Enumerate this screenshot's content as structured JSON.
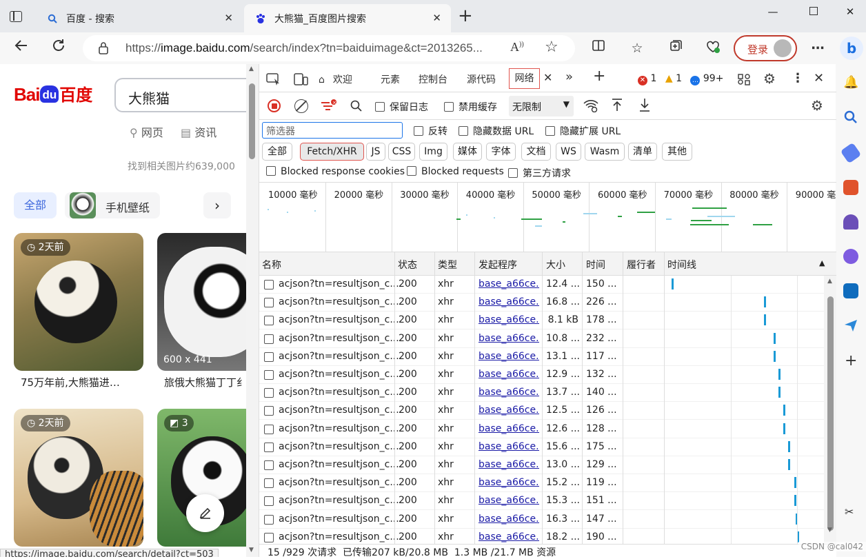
{
  "tabs": [
    {
      "title": "百度 - 搜索",
      "active": false
    },
    {
      "title": "大熊猫_百度图片搜索",
      "active": true
    }
  ],
  "address": {
    "url_prefix": "https://",
    "url_host": "image.baidu.com",
    "url_rest": "/search/index?tn=baiduimage&ct=2013265..."
  },
  "toolbar": {
    "login_label": "登录"
  },
  "baidu": {
    "logo_bai": "Bai",
    "logo_du": "du",
    "logo_cn": "百度",
    "search_query": "大熊猫",
    "nav_web": "网页",
    "nav_news": "资讯",
    "result_count": "找到相关图片约639,000",
    "filter_all": "全部",
    "filter_wallpaper": "手机壁纸",
    "cards": [
      {
        "badge": "2天前",
        "caption": "75万年前,大熊猫进…"
      },
      {
        "size": "600 x 441",
        "caption": "旅俄大熊猫丁丁纟"
      },
      {
        "badge": "2天前",
        "caption": ""
      },
      {
        "count": "3",
        "caption": ""
      }
    ],
    "status_url": "https://image.baidu.com/search/detail?ct=503"
  },
  "devtools": {
    "tabs": [
      "欢迎",
      "元素",
      "控制台",
      "源代码",
      "网络"
    ],
    "errors": "1",
    "warnings": "1",
    "messages": "99+",
    "preserve_log": "保留日志",
    "disable_cache": "禁用缓存",
    "throttle": "无限制",
    "filter_placeholder": "筛选器",
    "invert": "反转",
    "hide_data_url": "隐藏数据 URL",
    "hide_ext_url": "隐藏扩展 URL",
    "type_filters": [
      "全部",
      "Fetch/XHR",
      "JS",
      "CSS",
      "Img",
      "媒体",
      "字体",
      "文档",
      "WS",
      "Wasm",
      "清单",
      "其他"
    ],
    "blocked_cookies": "Blocked response cookies",
    "blocked_requests": "Blocked requests",
    "third_party": "第三方请求",
    "overview_ticks": [
      "10000 毫秒",
      "20000 毫秒",
      "30000 毫秒",
      "40000 毫秒",
      "50000 毫秒",
      "60000 毫秒",
      "70000 毫秒",
      "80000 毫秒",
      "90000 毫"
    ],
    "columns": [
      "名称",
      "状态",
      "类型",
      "发起程序",
      "大小",
      "时间",
      "履行者",
      "时间线"
    ],
    "rows": [
      {
        "name": "acjson?tn=resultjson_c...",
        "status": "200",
        "type": "xhr",
        "initiator": "base_a66ce...",
        "size": "12.4 ...",
        "time": "150 ...",
        "tl": 0.03
      },
      {
        "name": "acjson?tn=resultjson_c...",
        "status": "200",
        "type": "xhr",
        "initiator": "base_a66ce...",
        "size": "16.8 ...",
        "time": "226 ...",
        "tl": 0.62
      },
      {
        "name": "acjson?tn=resultjson_c...",
        "status": "200",
        "type": "xhr",
        "initiator": "base_a66ce...",
        "size": "8.1 kB",
        "time": "178 ...",
        "tl": 0.62
      },
      {
        "name": "acjson?tn=resultjson_c...",
        "status": "200",
        "type": "xhr",
        "initiator": "base_a66ce...",
        "size": "10.8 ...",
        "time": "232 ...",
        "tl": 0.68
      },
      {
        "name": "acjson?tn=resultjson_c...",
        "status": "200",
        "type": "xhr",
        "initiator": "base_a66ce...",
        "size": "13.1 ...",
        "time": "117 ...",
        "tl": 0.68
      },
      {
        "name": "acjson?tn=resultjson_c...",
        "status": "200",
        "type": "xhr",
        "initiator": "base_a66ce...",
        "size": "12.9 ...",
        "time": "132 ...",
        "tl": 0.71
      },
      {
        "name": "acjson?tn=resultjson_c...",
        "status": "200",
        "type": "xhr",
        "initiator": "base_a66ce...",
        "size": "13.7 ...",
        "time": "140 ...",
        "tl": 0.71
      },
      {
        "name": "acjson?tn=resultjson_c...",
        "status": "200",
        "type": "xhr",
        "initiator": "base_a66ce...",
        "size": "12.5 ...",
        "time": "126 ...",
        "tl": 0.74
      },
      {
        "name": "acjson?tn=resultjson_c...",
        "status": "200",
        "type": "xhr",
        "initiator": "base_a66ce...",
        "size": "12.6 ...",
        "time": "128 ...",
        "tl": 0.74
      },
      {
        "name": "acjson?tn=resultjson_c...",
        "status": "200",
        "type": "xhr",
        "initiator": "base_a66ce...",
        "size": "15.6 ...",
        "time": "175 ...",
        "tl": 0.77
      },
      {
        "name": "acjson?tn=resultjson_c...",
        "status": "200",
        "type": "xhr",
        "initiator": "base_a66ce...",
        "size": "13.0 ...",
        "time": "129 ...",
        "tl": 0.77
      },
      {
        "name": "acjson?tn=resultjson_c...",
        "status": "200",
        "type": "xhr",
        "initiator": "base_a66ce...",
        "size": "15.2 ...",
        "time": "119 ...",
        "tl": 0.81
      },
      {
        "name": "acjson?tn=resultjson_c...",
        "status": "200",
        "type": "xhr",
        "initiator": "base_a66ce...",
        "size": "15.3 ...",
        "time": "151 ...",
        "tl": 0.81
      },
      {
        "name": "acjson?tn=resultjson_c...",
        "status": "200",
        "type": "xhr",
        "initiator": "base_a66ce...",
        "size": "16.3 ...",
        "time": "147 ...",
        "tl": 0.82
      },
      {
        "name": "acjson?tn=resultjson_c...",
        "status": "200",
        "type": "xhr",
        "initiator": "base_a66ce...",
        "size": "18.2 ...",
        "time": "190 ...",
        "tl": 0.83
      }
    ],
    "status_bar": "15 /929 次请求  已传输207 kB/20.8 MB  1.3 MB /21.7 MB 资源"
  },
  "watermark": "CSDN @cal042",
  "colors": {
    "accent": "#2b6cd4",
    "baidu_red": "#e10602",
    "baidu_blue": "#2932e1",
    "timeline": "#1a9ad6",
    "login_border": "#c0392b"
  }
}
